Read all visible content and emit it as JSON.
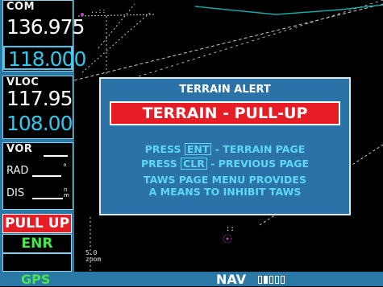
{
  "com": {
    "header": "COM",
    "active": "136.975",
    "standby": "118.000"
  },
  "vloc": {
    "header": "VLOC",
    "active": "117.95",
    "standby": "108.00"
  },
  "vor": {
    "header": "VOR",
    "rad_label": "RAD",
    "rad_unit": "°",
    "dis_label": "DIS",
    "dis_unit": "n m"
  },
  "annunciators": {
    "pull_up": "PULL UP",
    "mode": "ENR"
  },
  "bottom_bar": {
    "left_label": "GPS",
    "right_label": "NAV",
    "page_indicator": {
      "total": 5,
      "active": 1
    }
  },
  "map": {
    "range_label": "5.0",
    "mode_label": "zoom"
  },
  "alert": {
    "title": "TERRAIN ALERT",
    "banner": "TERRAIN - PULL-UP",
    "line1": {
      "prefix": "PRESS",
      "key": "ENT",
      "suffix": "- TERRAIN PAGE"
    },
    "line2": {
      "prefix": "PRESS",
      "key": "CLR",
      "suffix": "- PREVIOUS PAGE"
    },
    "note1": "TAWS PAGE MENU PROVIDES",
    "note2": "A MEANS TO INHIBIT TAWS"
  },
  "colors": {
    "panel_blue": "#2a78a6",
    "warning_red": "#e81c24",
    "cyan": "#30c8ee",
    "green": "#49e649"
  }
}
